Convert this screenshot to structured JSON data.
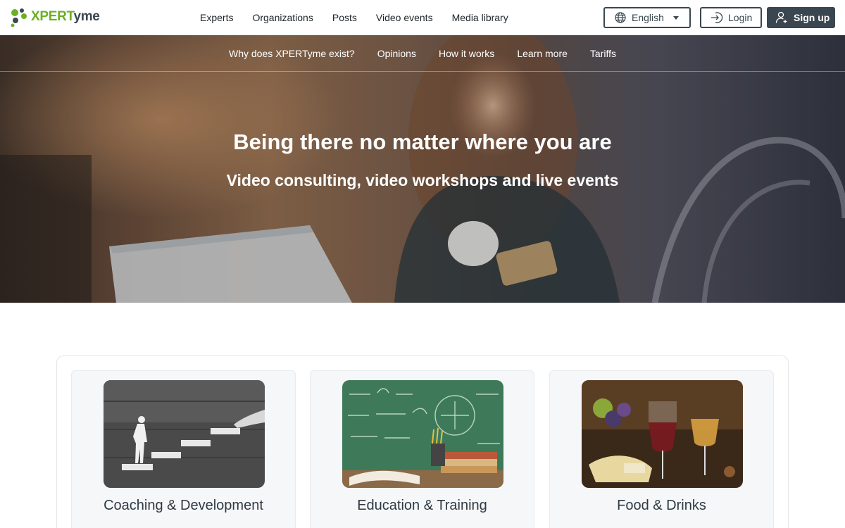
{
  "header": {
    "logo_text_green": "XPERT",
    "logo_text_dark": "yme",
    "nav": [
      "Experts",
      "Organizations",
      "Posts",
      "Video events",
      "Media library"
    ],
    "language_label": "English",
    "login_label": "Login",
    "signup_label": "Sign up"
  },
  "hero": {
    "sub_nav": [
      "Why does XPERTyme exist?",
      "Opinions",
      "How it works",
      "Learn more",
      "Tariffs"
    ],
    "title": "Being there no matter where you are",
    "subtitle": "Video consulting, video workshops and live events"
  },
  "categories": [
    {
      "title": "Coaching & Development"
    },
    {
      "title": "Education & Training"
    },
    {
      "title": "Food & Drinks"
    }
  ],
  "colors": {
    "brand_green": "#6ab023",
    "brand_dark": "#3a4750"
  }
}
